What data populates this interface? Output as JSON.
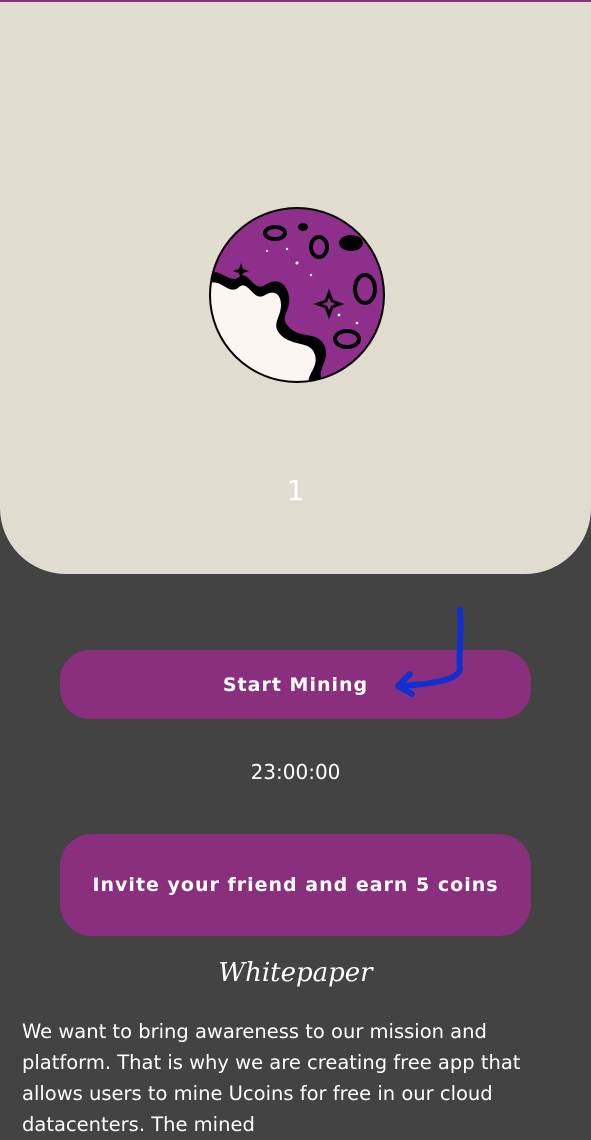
{
  "colors": {
    "background": "#434343",
    "card": "#e0ddd0",
    "accent": "#8a2f7e",
    "text": "#ffffff",
    "annotation_arrow": "#1030d0"
  },
  "hero": {
    "icon": "planet-icon",
    "coin_count": "1"
  },
  "actions": {
    "start_mining_label": "Start Mining",
    "timer": "23:00:00",
    "invite_label": "Invite your friend and earn 5 coins"
  },
  "whitepaper": {
    "title": "Whitepaper",
    "body": "We want to bring awareness to our mission and platform. That is why we are creating free app that allows users to mine Ucoins for free in our cloud datacenters.  The mined"
  }
}
